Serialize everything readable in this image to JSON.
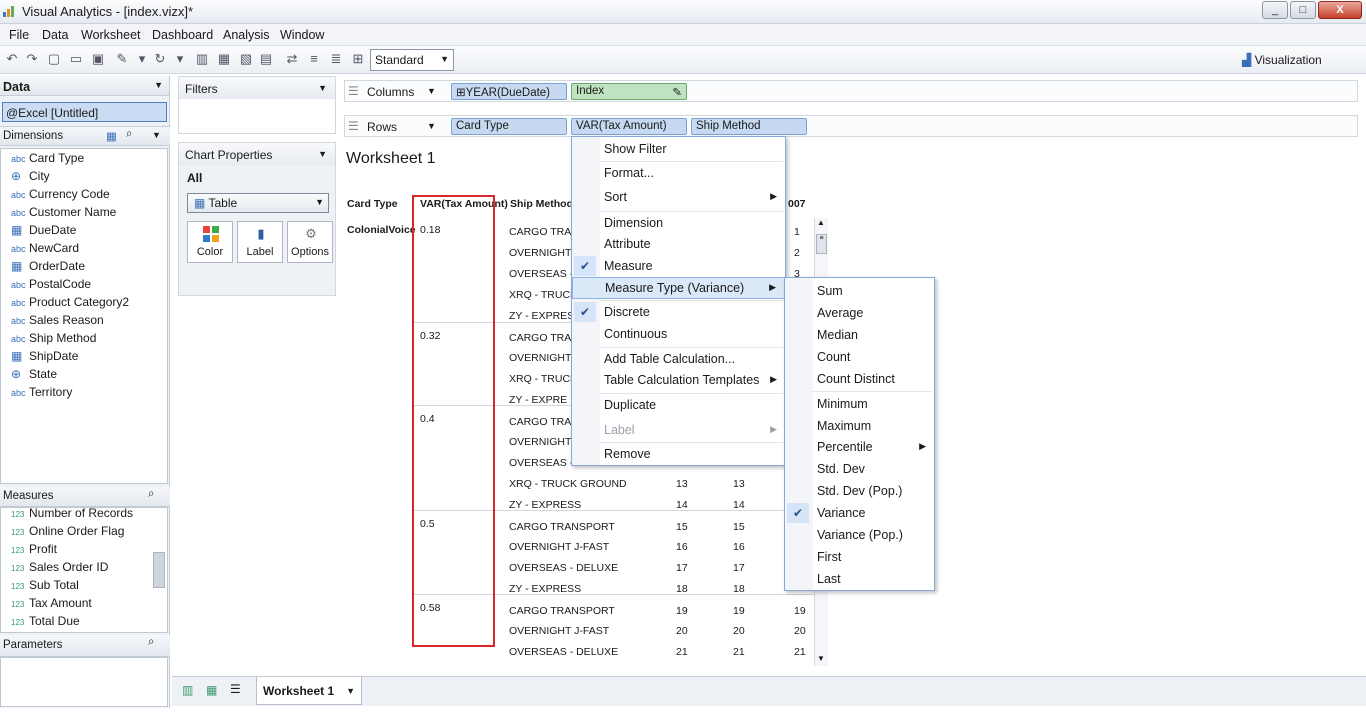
{
  "window": {
    "title": "Visual Analytics - [index.vizx]*",
    "min": "_",
    "max": "□",
    "close": "X"
  },
  "menubar": [
    "File",
    "Data",
    "Worksheet",
    "Dashboard",
    "Analysis",
    "Window"
  ],
  "toolbar": {
    "mode": "Standard",
    "viz": "Visualization"
  },
  "data_panel": {
    "title": "Data",
    "connection": "@Excel [Untitled]",
    "dimensions_label": "Dimensions",
    "dimensions": [
      {
        "icon": "abc",
        "name": "Card Type"
      },
      {
        "icon": "geo",
        "name": "City"
      },
      {
        "icon": "abc",
        "name": "Currency Code"
      },
      {
        "icon": "abc",
        "name": "Customer Name"
      },
      {
        "icon": "date",
        "name": "DueDate"
      },
      {
        "icon": "abc",
        "name": "NewCard"
      },
      {
        "icon": "date",
        "name": "OrderDate"
      },
      {
        "icon": "abc",
        "name": "PostalCode"
      },
      {
        "icon": "abc",
        "name": "Product Category2"
      },
      {
        "icon": "abc",
        "name": "Sales Reason"
      },
      {
        "icon": "abc",
        "name": "Ship Method"
      },
      {
        "icon": "date",
        "name": "ShipDate"
      },
      {
        "icon": "geo",
        "name": "State"
      },
      {
        "icon": "abc",
        "name": "Territory"
      }
    ],
    "measures_label": "Measures",
    "measures": [
      "Number of Records",
      "Online Order Flag",
      "Profit",
      "Sales Order ID",
      "Sub Total",
      "Tax Amount",
      "Total Due"
    ],
    "measure_icon": "123",
    "parameters_label": "Parameters"
  },
  "filters": {
    "title": "Filters"
  },
  "chart_props": {
    "title": "Chart Properties",
    "all": "All",
    "type": "Table",
    "buttons": [
      "Color",
      "Label",
      "Options"
    ]
  },
  "shelves": {
    "columns_label": "Columns",
    "rows_label": "Rows",
    "columns": [
      "YEAR(DueDate)",
      "Index"
    ],
    "rows": [
      "Card Type",
      "VAR(Tax Amount)",
      "Ship Method"
    ]
  },
  "worksheet": {
    "title": "Worksheet 1",
    "headers": [
      "Card Type",
      "VAR(Tax Amount)",
      "Ship Method",
      "007"
    ],
    "card_type": "ColonialVoice",
    "var_values": [
      "0.18",
      "0.32",
      "0.4",
      "0.5",
      "0.58"
    ],
    "ship_rows": [
      {
        "method": "CARGO TRA",
        "a": "",
        "b": "",
        "c": "1"
      },
      {
        "method": "OVERNIGHT",
        "a": "",
        "b": "",
        "c": "2"
      },
      {
        "method": "OVERSEAS -",
        "a": "",
        "b": "",
        "c": "3"
      },
      {
        "method": "XRQ - TRUCK",
        "a": "",
        "b": "",
        "c": ""
      },
      {
        "method": "ZY - EXPRESS",
        "a": "",
        "b": "",
        "c": ""
      },
      {
        "method": "CARGO TRA",
        "a": "",
        "b": "",
        "c": ""
      },
      {
        "method": "OVERNIGHT",
        "a": "",
        "b": "",
        "c": ""
      },
      {
        "method": "XRQ - TRUCK",
        "a": "",
        "b": "",
        "c": ""
      },
      {
        "method": "ZY - EXPRE",
        "a": "",
        "b": "",
        "c": ""
      },
      {
        "method": "CARGO TRA",
        "a": "",
        "b": "",
        "c": ""
      },
      {
        "method": "OVERNIGHT",
        "a": "",
        "b": "",
        "c": ""
      },
      {
        "method": "OVERSEAS -",
        "a": "",
        "b": "",
        "c": ""
      },
      {
        "method": "XRQ - TRUCK GROUND",
        "a": "13",
        "b": "13",
        "c": ""
      },
      {
        "method": "ZY - EXPRESS",
        "a": "14",
        "b": "14",
        "c": ""
      },
      {
        "method": "CARGO TRANSPORT",
        "a": "15",
        "b": "15",
        "c": ""
      },
      {
        "method": "OVERNIGHT J-FAST",
        "a": "16",
        "b": "16",
        "c": ""
      },
      {
        "method": "OVERSEAS - DELUXE",
        "a": "17",
        "b": "17",
        "c": ""
      },
      {
        "method": "ZY - EXPRESS",
        "a": "18",
        "b": "18",
        "c": ""
      },
      {
        "method": "CARGO TRANSPORT",
        "a": "19",
        "b": "19",
        "c": "19"
      },
      {
        "method": "OVERNIGHT J-FAST",
        "a": "20",
        "b": "20",
        "c": "20"
      },
      {
        "method": "OVERSEAS - DELUXE",
        "a": "21",
        "b": "21",
        "c": "21"
      }
    ]
  },
  "tabs": {
    "active": "Worksheet 1"
  },
  "context_menu": [
    {
      "label": "Show Filter"
    },
    {
      "label": "Format..."
    },
    {
      "label": "Sort",
      "sub": true
    },
    {
      "label": "Dimension"
    },
    {
      "label": "Attribute"
    },
    {
      "label": "Measure",
      "checked": true
    },
    {
      "label": "Measure Type (Variance)",
      "sub": true,
      "highlight": true
    },
    {
      "label": "Discrete",
      "checked": true
    },
    {
      "label": "Continuous"
    },
    {
      "label": "Add Table Calculation..."
    },
    {
      "label": "Table Calculation Templates",
      "sub": true
    },
    {
      "label": "Duplicate"
    },
    {
      "label": "Label",
      "sub": true,
      "disabled": true
    },
    {
      "label": "Remove"
    }
  ],
  "submenu": [
    {
      "label": "Sum"
    },
    {
      "label": "Average"
    },
    {
      "label": "Median"
    },
    {
      "label": "Count"
    },
    {
      "label": "Count Distinct"
    },
    {
      "label": "Minimum"
    },
    {
      "label": "Maximum"
    },
    {
      "label": "Percentile",
      "sub": true
    },
    {
      "label": "Std. Dev"
    },
    {
      "label": "Std. Dev (Pop.)"
    },
    {
      "label": "Variance",
      "checked": true
    },
    {
      "label": "Variance (Pop.)"
    },
    {
      "label": "First"
    },
    {
      "label": "Last"
    }
  ],
  "colors": {
    "accent": "#3a6fb8",
    "highlight_box": "#d9262c",
    "pill": "#c6d9f1",
    "pill_green": "#bfe3c0"
  }
}
